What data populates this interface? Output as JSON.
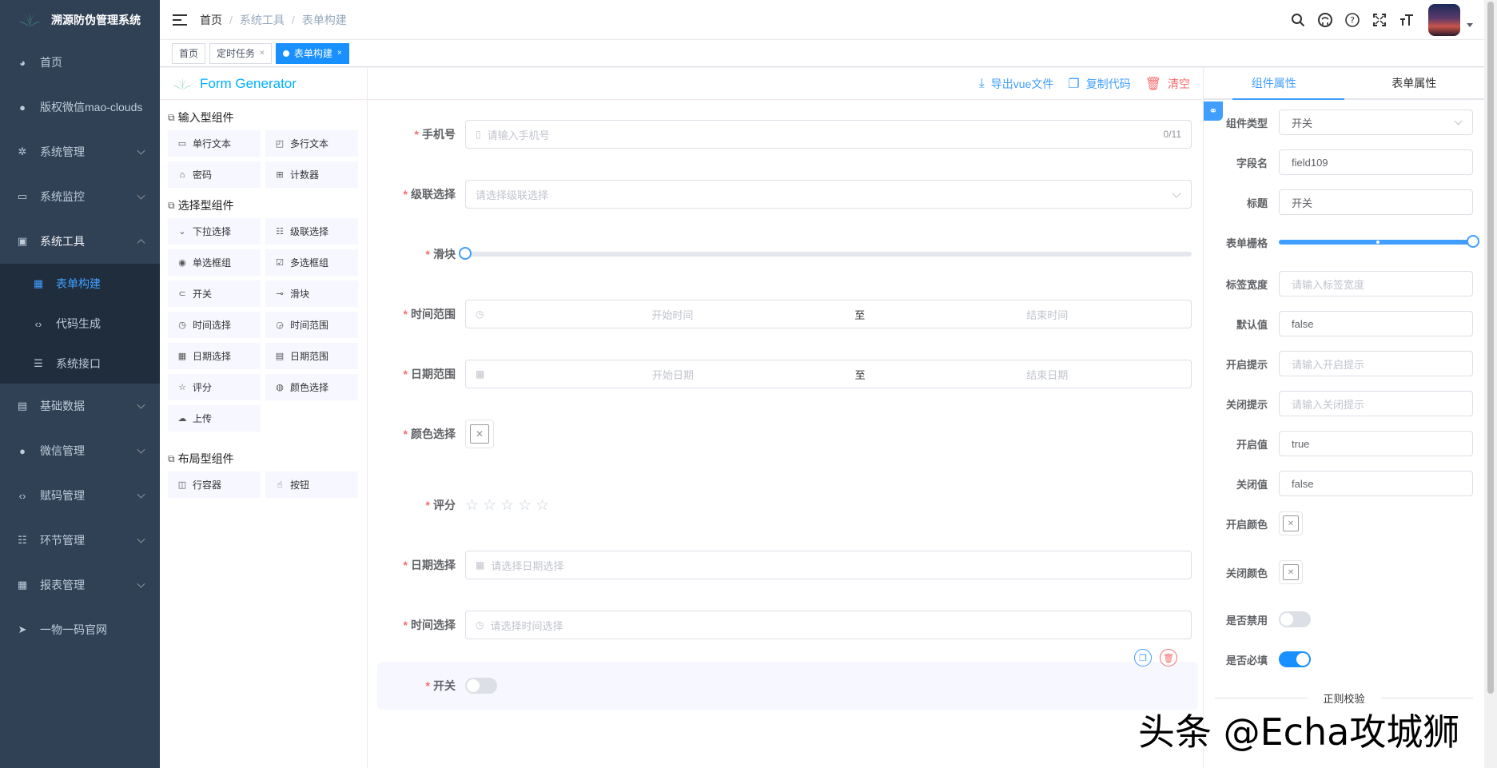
{
  "app": {
    "title": "溯源防伪管理系统"
  },
  "sidebar": {
    "items": [
      {
        "label": "首页",
        "icon": "dashboard-icon"
      },
      {
        "label": "版权微信mao-clouds",
        "icon": "wechat-icon"
      },
      {
        "label": "系统管理",
        "icon": "gear-icon"
      },
      {
        "label": "系统监控",
        "icon": "monitor-icon"
      },
      {
        "label": "系统工具",
        "icon": "toolbox-icon"
      }
    ],
    "submenu": [
      {
        "label": "表单构建",
        "icon": "form-icon"
      },
      {
        "label": "代码生成",
        "icon": "code-icon"
      },
      {
        "label": "系统接口",
        "icon": "sliders-icon"
      }
    ],
    "items_after": [
      {
        "label": "基础数据",
        "icon": "table-icon"
      },
      {
        "label": "微信管理",
        "icon": "wechat-icon"
      },
      {
        "label": "赋码管理",
        "icon": "code-icon"
      },
      {
        "label": "环节管理",
        "icon": "list-icon"
      },
      {
        "label": "报表管理",
        "icon": "grid-icon"
      },
      {
        "label": "一物一码官网",
        "icon": "send-icon"
      }
    ]
  },
  "breadcrumb": [
    "首页",
    "系统工具",
    "表单构建"
  ],
  "tags": [
    {
      "label": "首页"
    },
    {
      "label": "定时任务"
    },
    {
      "label": "表单构建"
    }
  ],
  "form_generator": {
    "title": "Form Generator",
    "actions": {
      "export": "导出vue文件",
      "copy": "复制代码",
      "clear": "清空"
    }
  },
  "components": {
    "input_title": "输入型组件",
    "input": [
      "单行文本",
      "多行文本",
      "密码",
      "计数器"
    ],
    "select_title": "选择型组件",
    "select": [
      "下拉选择",
      "级联选择",
      "单选框组",
      "多选框组",
      "开关",
      "滑块",
      "时间选择",
      "时间范围",
      "日期选择",
      "日期范围",
      "评分",
      "颜色选择",
      "上传"
    ],
    "layout_title": "布局型组件",
    "layout": [
      "行容器",
      "按钮"
    ]
  },
  "form": {
    "phone": {
      "label": "手机号",
      "placeholder": "请输入手机号",
      "count": "0/11"
    },
    "cascader": {
      "label": "级联选择",
      "placeholder": "请选择级联选择"
    },
    "slider": {
      "label": "滑块"
    },
    "time_range": {
      "label": "时间范围",
      "start": "开始时间",
      "sep": "至",
      "end": "结束时间"
    },
    "date_range": {
      "label": "日期范围",
      "start": "开始日期",
      "sep": "至",
      "end": "结束日期"
    },
    "color": {
      "label": "颜色选择"
    },
    "rate": {
      "label": "评分",
      "stars": "☆☆☆☆☆"
    },
    "date": {
      "label": "日期选择",
      "placeholder": "请选择日期选择"
    },
    "time": {
      "label": "时间选择",
      "placeholder": "请选择时间选择"
    },
    "switch": {
      "label": "开关"
    }
  },
  "props": {
    "tabs": [
      "组件属性",
      "表单属性"
    ],
    "type": {
      "label": "组件类型",
      "value": "开关"
    },
    "field": {
      "label": "字段名",
      "value": "field109"
    },
    "title": {
      "label": "标题",
      "value": "开关"
    },
    "span": {
      "label": "表单栅格",
      "value": 24
    },
    "label_width": {
      "label": "标签宽度",
      "placeholder": "请输入标签宽度"
    },
    "default": {
      "label": "默认值",
      "value": "false"
    },
    "active_text": {
      "label": "开启提示",
      "placeholder": "请输入开启提示"
    },
    "inactive_text": {
      "label": "关闭提示",
      "placeholder": "请输入关闭提示"
    },
    "active_value": {
      "label": "开启值",
      "value": "true"
    },
    "inactive_value": {
      "label": "关闭值",
      "value": "false"
    },
    "active_color": {
      "label": "开启颜色"
    },
    "inactive_color": {
      "label": "关闭颜色"
    },
    "disabled": {
      "label": "是否禁用",
      "value": false
    },
    "required": {
      "label": "是否必填",
      "value": true
    },
    "regex_title": "正则校验"
  },
  "watermark": "头条 @Echa攻城狮",
  "colors": {
    "sidebar_bg": "#304156",
    "submenu_bg": "#1f2d3d",
    "accent": "#409eff",
    "danger": "#f56c6c",
    "tag_active": "#1890ff"
  }
}
